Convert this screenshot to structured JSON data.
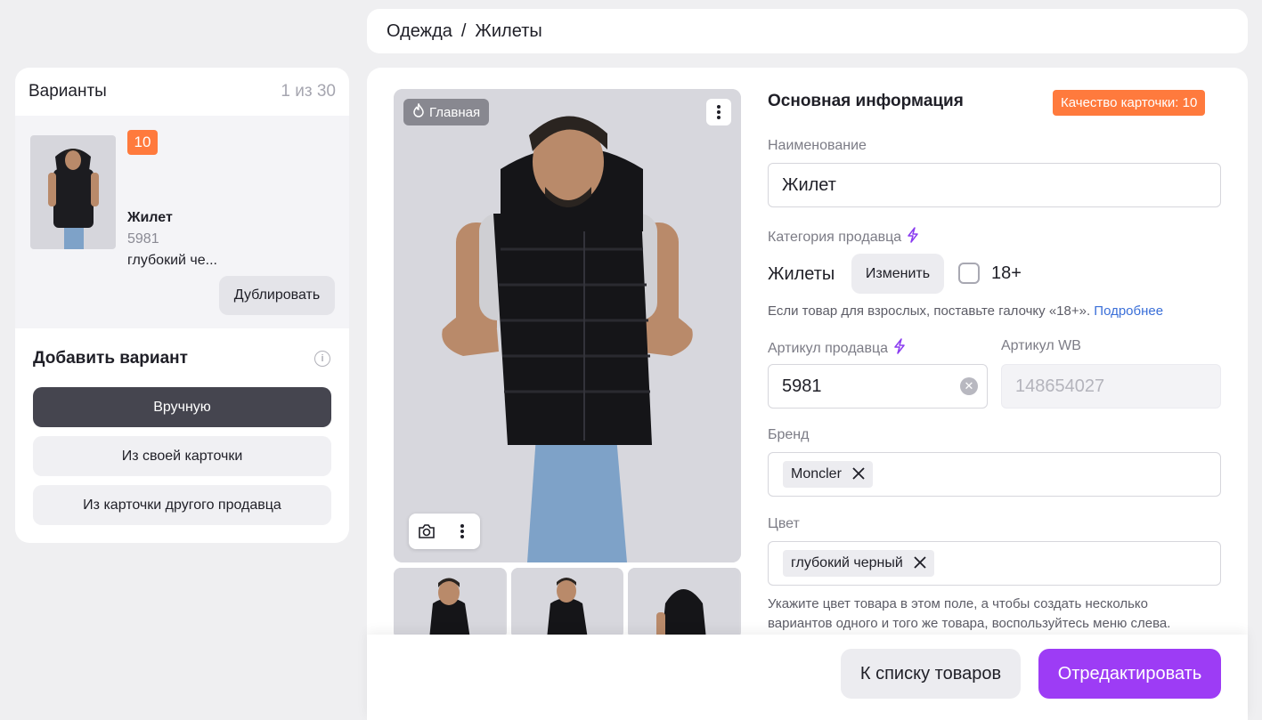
{
  "breadcrumb": {
    "parent": "Одежда",
    "separator": "/",
    "current": "Жилеты"
  },
  "variants": {
    "title": "Варианты",
    "count": "1 из 30",
    "item": {
      "badge": "10",
      "name": "Жилет",
      "article": "5981",
      "color": "глубокий че..."
    },
    "duplicate_label": "Дублировать",
    "add_title": "Добавить вариант",
    "add_manual": "Вручную",
    "add_from_own": "Из своей карточки",
    "add_from_other": "Из карточки другого продавца"
  },
  "photos": {
    "main_label": "Главная"
  },
  "info": {
    "section_title": "Основная информация",
    "quality_badge": "Качество карточки: 10",
    "name_label": "Наименование",
    "name_value": "Жилет",
    "category_label": "Категория продавца",
    "category_value": "Жилеты",
    "change_label": "Изменить",
    "age_label": "18+",
    "age_hint": "Если товар для взрослых, поставьте галочку «18+».",
    "age_hint_link": "Подробнее",
    "seller_article_label": "Артикул продавца",
    "seller_article_value": "5981",
    "wb_article_label": "Артикул WB",
    "wb_article_value": "148654027",
    "brand_label": "Бренд",
    "brand_value": "Moncler",
    "color_label": "Цвет",
    "color_value": "глубокий черный",
    "color_hint_line1": "Укажите цвет товара в этом поле, а чтобы создать несколько",
    "color_hint_line2": "вариантов одного и того же товара, воспользуйтесь меню слева."
  },
  "footer": {
    "back_label": "К списку товаров",
    "edit_label": "Отредактировать"
  },
  "colors": {
    "accent": "#9d3cf5",
    "badge": "#ff7a3d",
    "link": "#3a6fd8"
  }
}
